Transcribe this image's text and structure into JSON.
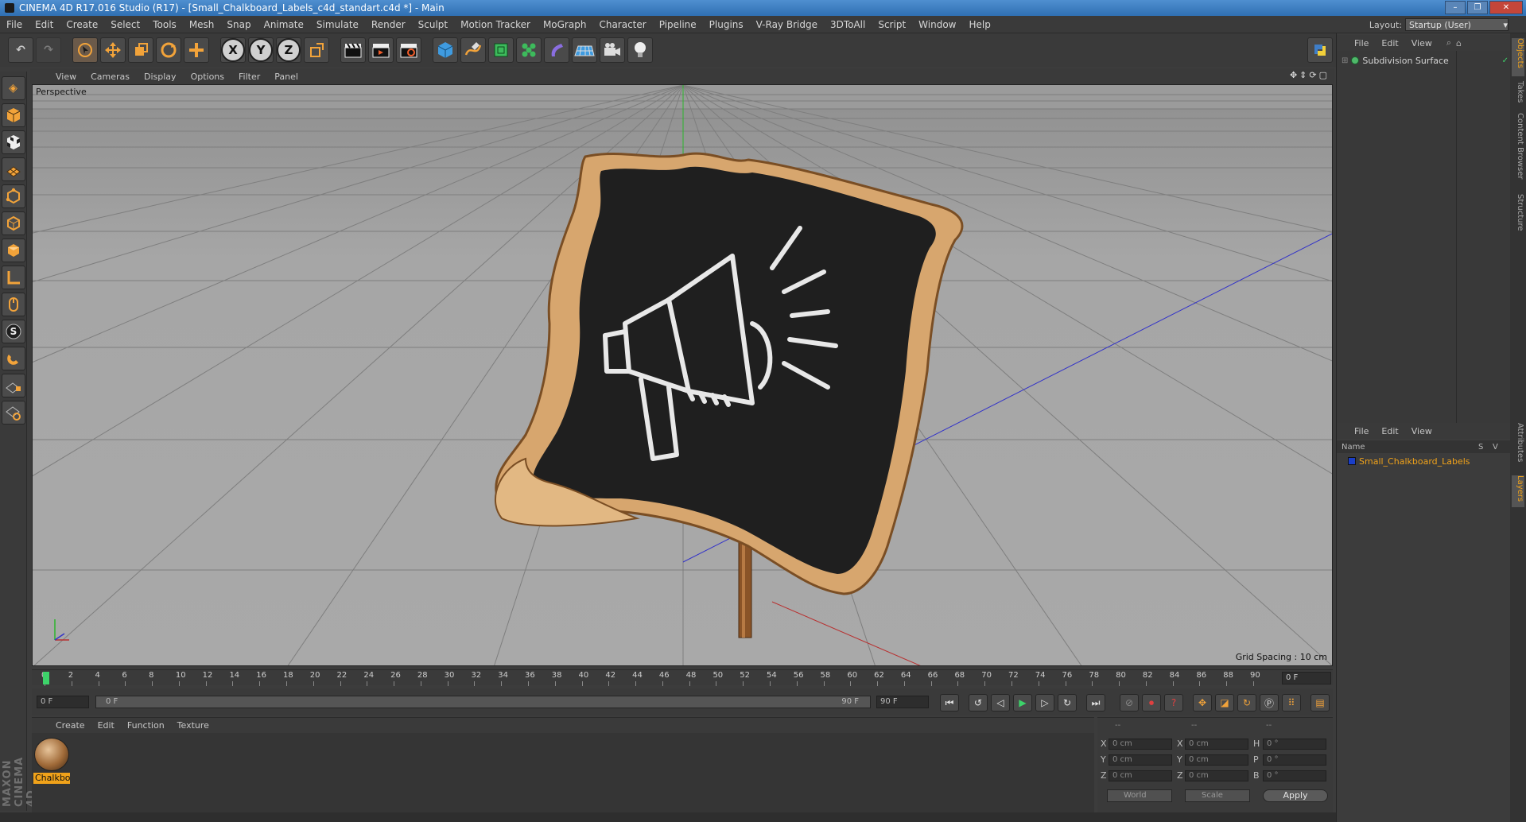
{
  "window": {
    "title": "CINEMA 4D R17.016 Studio (R17) - [Small_Chalkboard_Labels_c4d_standart.c4d *] - Main",
    "controls": [
      "–",
      "❐",
      "✕"
    ]
  },
  "menubar": {
    "items": [
      "File",
      "Edit",
      "Create",
      "Select",
      "Tools",
      "Mesh",
      "Snap",
      "Animate",
      "Simulate",
      "Render",
      "Sculpt",
      "Motion Tracker",
      "MoGraph",
      "Character",
      "Pipeline",
      "Plugins",
      "V-Ray Bridge",
      "3DToAll",
      "Script",
      "Window",
      "Help"
    ],
    "layout_label": "Layout:",
    "layout_value": "Startup (User)"
  },
  "toolbar": {
    "undo_icon": "↶",
    "redo_icon": "↷",
    "axis_x": "X",
    "axis_y": "Y",
    "axis_z": "Z"
  },
  "viewport": {
    "menu": [
      "View",
      "Cameras",
      "Display",
      "Options",
      "Filter",
      "Panel"
    ],
    "label": "Perspective",
    "grid_spacing": "Grid Spacing : 10 cm",
    "nav_icons": "✥⇕⟳▢"
  },
  "timeline": {
    "ticks": [
      0,
      2,
      4,
      6,
      8,
      10,
      12,
      14,
      16,
      18,
      20,
      22,
      24,
      26,
      28,
      30,
      32,
      34,
      36,
      38,
      40,
      42,
      44,
      46,
      48,
      50,
      52,
      54,
      56,
      58,
      60,
      62,
      64,
      66,
      68,
      70,
      72,
      74,
      76,
      78,
      80,
      82,
      84,
      86,
      88,
      90
    ],
    "current_frame": "0 F",
    "start_frame": "0 F",
    "range_start": "0 F",
    "range_end": "90 F",
    "end_frame": "90 F"
  },
  "materials": {
    "menu": [
      "Create",
      "Edit",
      "Function",
      "Texture"
    ],
    "material_name": "Chalkboard"
  },
  "coordinates": {
    "headers": [
      "--",
      "--",
      "--"
    ],
    "rows": [
      {
        "axis": "X",
        "pos": "0 cm",
        "size_axis": "X",
        "size": "0 cm",
        "rot_axis": "H",
        "rot": "0 °"
      },
      {
        "axis": "Y",
        "pos": "0 cm",
        "size_axis": "Y",
        "size": "0 cm",
        "rot_axis": "P",
        "rot": "0 °"
      },
      {
        "axis": "Z",
        "pos": "0 cm",
        "size_axis": "Z",
        "size": "0 cm",
        "rot_axis": "B",
        "rot": "0 °"
      }
    ],
    "mode": "World",
    "type": "Scale",
    "apply": "Apply"
  },
  "objects_panel": {
    "menu": [
      "File",
      "Edit",
      "View"
    ],
    "object_name": "Subdivision Surface"
  },
  "layers_panel": {
    "menu": [
      "File",
      "Edit",
      "View"
    ],
    "col_name": "Name",
    "col_s": "S",
    "col_v": "V",
    "layer_name": "Small_Chalkboard_Labels"
  },
  "side_tabs": [
    "Objects",
    "Takes",
    "Content Browser",
    "Structure",
    "Attributes",
    "Layers"
  ],
  "brand": "MAXON CINEMA 4D"
}
